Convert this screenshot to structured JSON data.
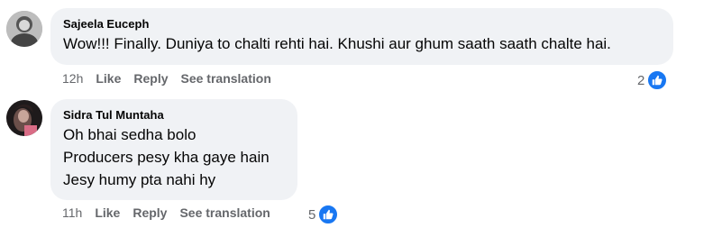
{
  "comments": [
    {
      "author": "Sajeela Euceph",
      "lines": [
        "Wow!!! Finally. Duniya to chalti rehti hai. Khushi aur ghum saath saath chalte hai."
      ],
      "time": "12h",
      "like_label": "Like",
      "reply_label": "Reply",
      "translate_label": "See translation",
      "reaction_count": "2"
    },
    {
      "author": "Sidra Tul Muntaha",
      "lines": [
        "Oh bhai sedha bolo",
        "Producers pesy kha gaye hain",
        "Jesy humy pta nahi hy"
      ],
      "time": "11h",
      "like_label": "Like",
      "reply_label": "Reply",
      "translate_label": "See translation",
      "reaction_count": "5"
    }
  ],
  "colors": {
    "bubble": "#f0f2f5",
    "meta_text": "#65676b",
    "like_blue": "#1877f2"
  }
}
